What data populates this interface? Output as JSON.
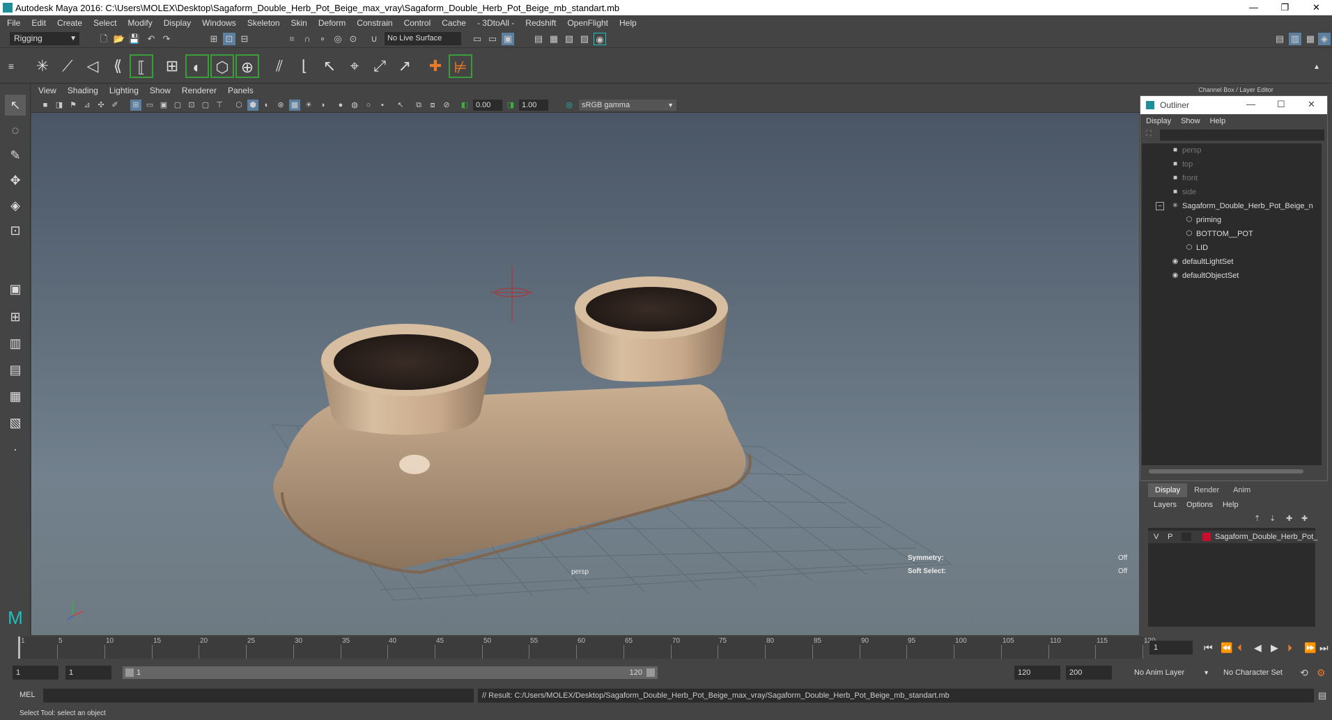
{
  "window": {
    "title": "Autodesk Maya 2016: C:\\Users\\MOLEX\\Desktop\\Sagaform_Double_Herb_Pot_Beige_max_vray\\Sagaform_Double_Herb_Pot_Beige_mb_standart.mb",
    "minimize": "—",
    "restore": "❐",
    "close": "✕"
  },
  "menubar": [
    "File",
    "Edit",
    "Create",
    "Select",
    "Modify",
    "Display",
    "Windows",
    "Skeleton",
    "Skin",
    "Deform",
    "Constrain",
    "Control",
    "Cache",
    "- 3DtoAll -",
    "Redshift",
    "OpenFlight",
    "Help"
  ],
  "statusline": {
    "mode": "Rigging",
    "live_surface": "No Live Surface"
  },
  "viewport": {
    "menu": [
      "View",
      "Shading",
      "Lighting",
      "Show",
      "Renderer",
      "Panels"
    ],
    "exposure": "0.00",
    "gamma": "1.00",
    "color_space": "sRGB gamma",
    "camera_label": "persp",
    "symmetry_label": "Symmetry:",
    "symmetry_value": "Off",
    "softselect_label": "Soft Select:",
    "softselect_value": "Off"
  },
  "right_panel": {
    "title": "Channel Box / Layer Editor"
  },
  "outliner": {
    "title": "Outliner",
    "menu": [
      "Display",
      "Show",
      "Help"
    ],
    "items": [
      {
        "name": "persp",
        "icon": "camera-icon",
        "dim": true
      },
      {
        "name": "top",
        "icon": "camera-icon",
        "dim": true
      },
      {
        "name": "front",
        "icon": "camera-icon",
        "dim": true
      },
      {
        "name": "side",
        "icon": "camera-icon",
        "dim": true
      },
      {
        "name": "Sagaform_Double_Herb_Pot_Beige_n",
        "icon": "group-icon",
        "dim": false
      },
      {
        "name": "priming",
        "icon": "mesh-icon",
        "dim": false
      },
      {
        "name": "BOTTOM__POT",
        "icon": "mesh-icon",
        "dim": false
      },
      {
        "name": "LID",
        "icon": "mesh-icon",
        "dim": false
      },
      {
        "name": "defaultLightSet",
        "icon": "set-icon",
        "dim": false
      },
      {
        "name": "defaultObjectSet",
        "icon": "set-icon",
        "dim": false
      }
    ]
  },
  "layer_editor": {
    "tabs": [
      "Display",
      "Render",
      "Anim"
    ],
    "menu": [
      "Layers",
      "Options",
      "Help"
    ],
    "layer": {
      "v": "V",
      "p": "P",
      "name": "Sagaform_Double_Herb_Pot_",
      "color": "#c8102e"
    }
  },
  "timeline": {
    "ticks": [
      "1",
      "5",
      "10",
      "15",
      "20",
      "25",
      "30",
      "35",
      "40",
      "45",
      "50",
      "55",
      "60",
      "65",
      "70",
      "75",
      "80",
      "85",
      "90",
      "95",
      "100",
      "105",
      "110",
      "115",
      "120"
    ],
    "current_frame": "1"
  },
  "range": {
    "start": "1",
    "start_inner": "1",
    "slider_start": "1",
    "slider_end": "120",
    "end_inner": "120",
    "end": "200",
    "anim_layer": "No Anim Layer",
    "char_set": "No Character Set"
  },
  "cmdline": {
    "lang": "MEL",
    "result": "// Result: C:/Users/MOLEX/Desktop/Sagaform_Double_Herb_Pot_Beige_max_vray/Sagaform_Double_Herb_Pot_Beige_mb_standart.mb"
  },
  "helpline": "Select Tool: select an object"
}
